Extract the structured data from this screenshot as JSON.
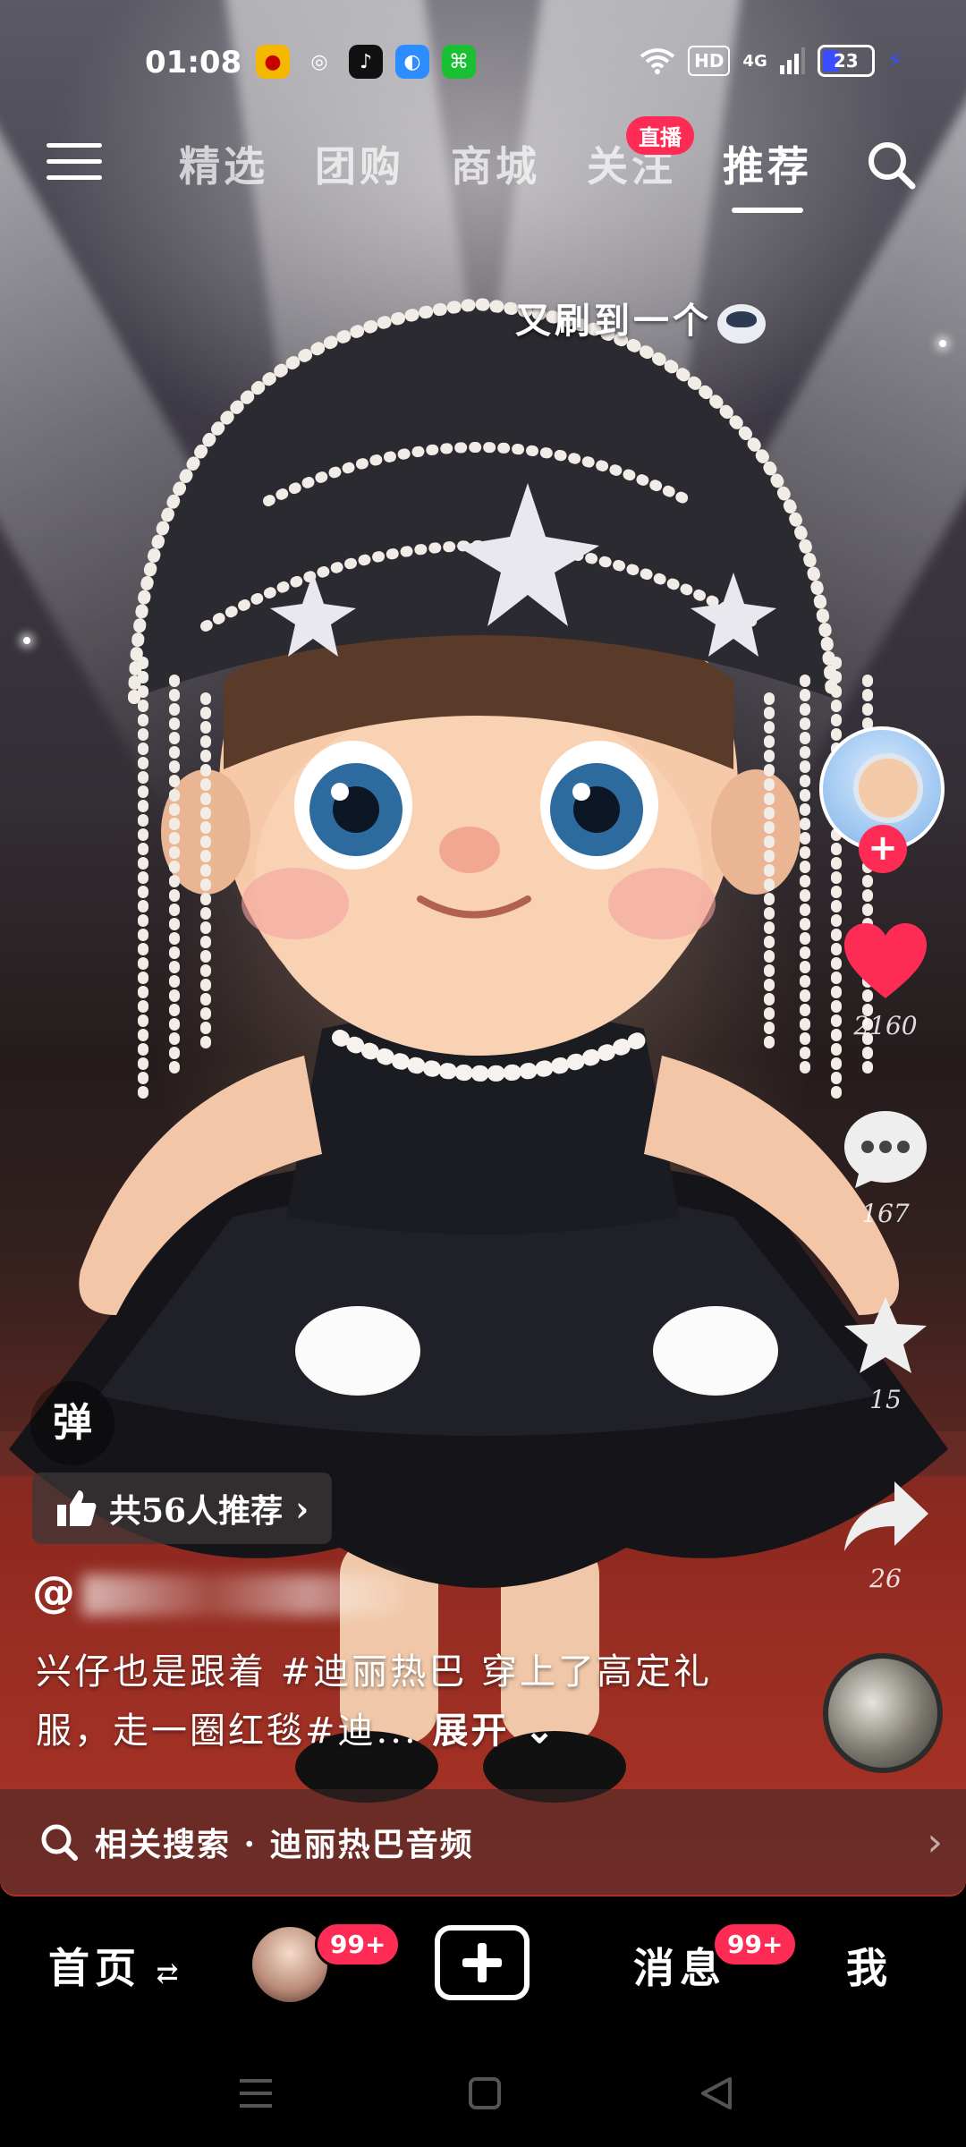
{
  "status_bar": {
    "time": "01:08",
    "apps": [
      {
        "icon": "weibo-icon",
        "color": "#f5b800"
      },
      {
        "icon": "wechat-icon",
        "color": "#1aad19"
      },
      {
        "icon": "tiktok-icon",
        "color": "#111111"
      },
      {
        "icon": "app-blue-icon",
        "color": "#2d8cff"
      },
      {
        "icon": "app-green-icon",
        "color": "#19c132"
      }
    ],
    "hd": "HD",
    "network": "4G",
    "battery": "23"
  },
  "top_nav": {
    "tabs": [
      "精选",
      "团购",
      "商城",
      "关注",
      "推荐"
    ],
    "active_tab": "推荐",
    "live_badge": "直播"
  },
  "toast": "又刷到一个",
  "right_rail": {
    "likes": "2160",
    "comments": "167",
    "favorites": "15",
    "shares": "26"
  },
  "danmu_label": "弹",
  "recommend_bar": "共56人推荐",
  "author_prefix": "@",
  "caption": {
    "text": "兴仔也是跟着 #迪丽热巴 穿上了高定礼服，走一圈红毯#迪...",
    "expand": "展开"
  },
  "related_search": "相关搜索 · 迪丽热巴音频",
  "bottom_nav": {
    "home": "首页",
    "friends_badge": "99+",
    "messages": "消息",
    "messages_badge": "99+",
    "me": "我"
  },
  "colors": {
    "accent": "#fe2c55",
    "like": "#fe2c55"
  }
}
